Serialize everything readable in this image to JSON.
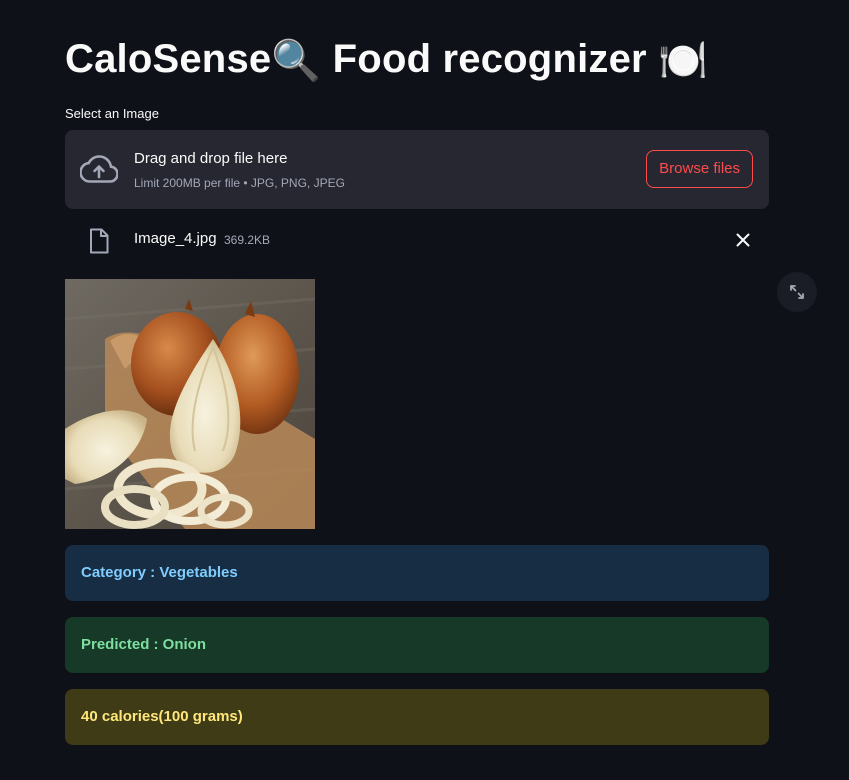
{
  "app": {
    "title": "CaloSense",
    "title_emoji_1": "🔍",
    "title_rest": " Food recognizer",
    "title_emoji_2": "🍽️"
  },
  "uploader": {
    "label": "Select an Image",
    "drag_text": "Drag and drop file here",
    "limit_text": "Limit 200MB per file • JPG, PNG, JPEG",
    "browse_label": "Browse files",
    "icon": "cloud-upload-icon"
  },
  "uploaded_file": {
    "name": "Image_4.jpg",
    "size": "369.2KB",
    "icon": "file-icon",
    "remove_icon": "close-icon"
  },
  "image": {
    "alt": "onion",
    "fullscreen_icon": "expand-icon"
  },
  "results": {
    "category": "Category : Vegetables",
    "predicted": "Predicted : Onion",
    "calories": "40 calories(100 grams)"
  },
  "colors": {
    "background": "#0e1117",
    "accent": "#ff4b4b",
    "info_bg": "#172d43",
    "success_bg": "#173928",
    "warning_bg": "#3e3b16"
  }
}
